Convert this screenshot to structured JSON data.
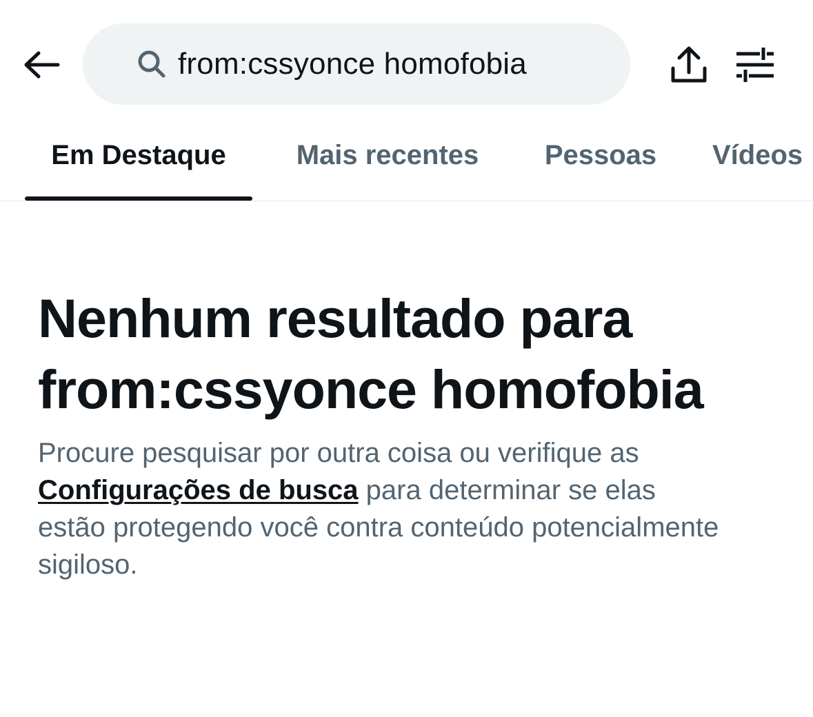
{
  "header": {
    "back_icon": "arrow-left-icon",
    "search": {
      "icon": "search-icon",
      "query": "from:cssyonce homofobia"
    },
    "share_icon": "share-upload-icon",
    "filter_icon": "filter-sliders-icon"
  },
  "tabs": [
    {
      "label": "Em Destaque",
      "active": true
    },
    {
      "label": "Mais recentes",
      "active": false
    },
    {
      "label": "Pessoas",
      "active": false
    },
    {
      "label": "Vídeos",
      "active": false
    }
  ],
  "empty_state": {
    "title_line1": "Nenhum resultado para",
    "title_line2": "from:cssyonce homofobia",
    "description_before": "Procure pesquisar por outra coisa ou verifique as ",
    "link_text": "Configurações de busca",
    "description_after": " para determinar se elas estão protegendo você contra conteúdo potencialmente sigiloso."
  },
  "colors": {
    "text_primary": "#0f1419",
    "text_secondary": "#536471",
    "search_bg": "#eff3f4",
    "divider": "#e1e5e8"
  }
}
